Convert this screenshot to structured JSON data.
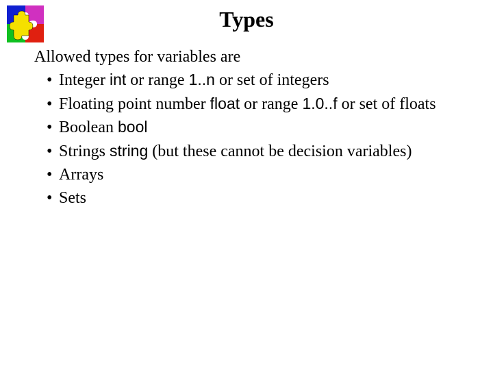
{
  "title": "Types",
  "intro": "Allowed types for variables are",
  "items": {
    "integer": {
      "t1": "Integer ",
      "code1": "int",
      "t2": " or range ",
      "code2": "1..n",
      "t3": " or set of integers"
    },
    "float": {
      "t1": "Floating point number ",
      "code1": "float",
      "t2": " or range ",
      "code2": "1.0..f",
      "t3": " or set of floats"
    },
    "bool": {
      "t1": "Boolean ",
      "code1": "bool"
    },
    "string": {
      "t1": "Strings ",
      "code1": "string",
      "t2": "  (but these cannot be decision variables)"
    },
    "arrays": {
      "t1": "Arrays"
    },
    "sets": {
      "t1": "Sets"
    }
  }
}
